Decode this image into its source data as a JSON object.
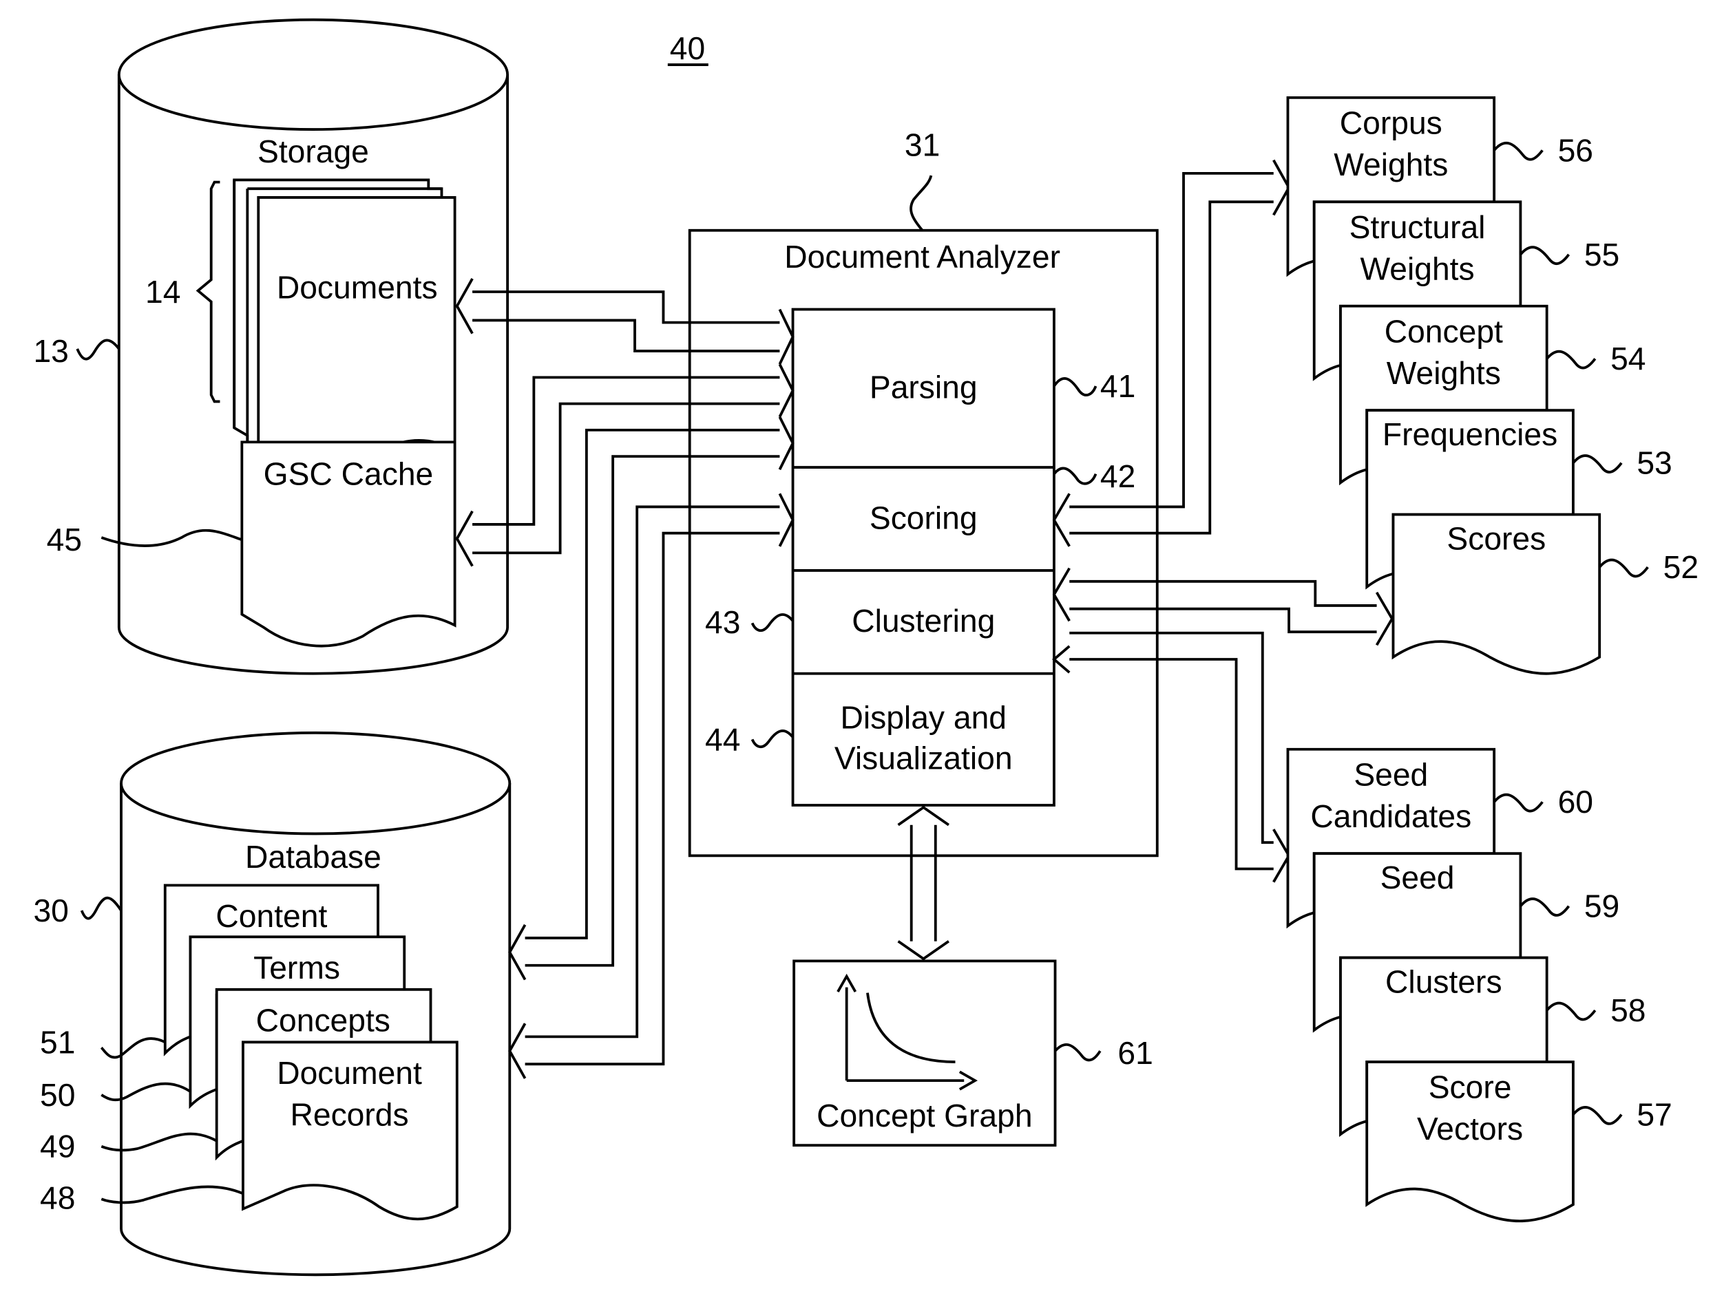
{
  "figure": {
    "number": "40"
  },
  "storage": {
    "label": "Storage",
    "ref": "13",
    "documents": {
      "label": "Documents",
      "ref": "14"
    },
    "gsc_cache": {
      "label": "GSC Cache",
      "ref": "45"
    }
  },
  "database": {
    "label": "Database",
    "ref": "30",
    "items": [
      {
        "label": "Content",
        "ref": "51"
      },
      {
        "label": "Terms",
        "ref": "50"
      },
      {
        "label": "Concepts",
        "ref": "49"
      },
      {
        "label_line1": "Document",
        "label_line2": "Records",
        "ref": "48"
      }
    ]
  },
  "analyzer": {
    "label": "Document Analyzer",
    "ref": "31",
    "modules": [
      {
        "label": "Parsing",
        "ref": "41"
      },
      {
        "label": "Scoring",
        "ref": "42"
      },
      {
        "label": "Clustering",
        "ref": "43"
      },
      {
        "label_line1": "Display and",
        "label_line2": "Visualization",
        "ref": "44"
      }
    ]
  },
  "concept_graph": {
    "label": "Concept Graph",
    "ref": "61"
  },
  "weights_stack": [
    {
      "label_line1": "Corpus",
      "label_line2": "Weights",
      "ref": "56"
    },
    {
      "label_line1": "Structural",
      "label_line2": "Weights",
      "ref": "55"
    },
    {
      "label_line1": "Concept",
      "label_line2": "Weights",
      "ref": "54"
    },
    {
      "label_line1": "Frequencies",
      "label_line2": "",
      "ref": "53"
    },
    {
      "label_line1": "Scores",
      "label_line2": "",
      "ref": "52"
    }
  ],
  "cluster_stack": [
    {
      "label_line1": "Seed",
      "label_line2": "Candidates",
      "ref": "60"
    },
    {
      "label_line1": "Seed",
      "label_line2": "",
      "ref": "59"
    },
    {
      "label_line1": "Clusters",
      "label_line2": "",
      "ref": "58"
    },
    {
      "label_line1": "Score",
      "label_line2": "Vectors",
      "ref": "57"
    }
  ]
}
